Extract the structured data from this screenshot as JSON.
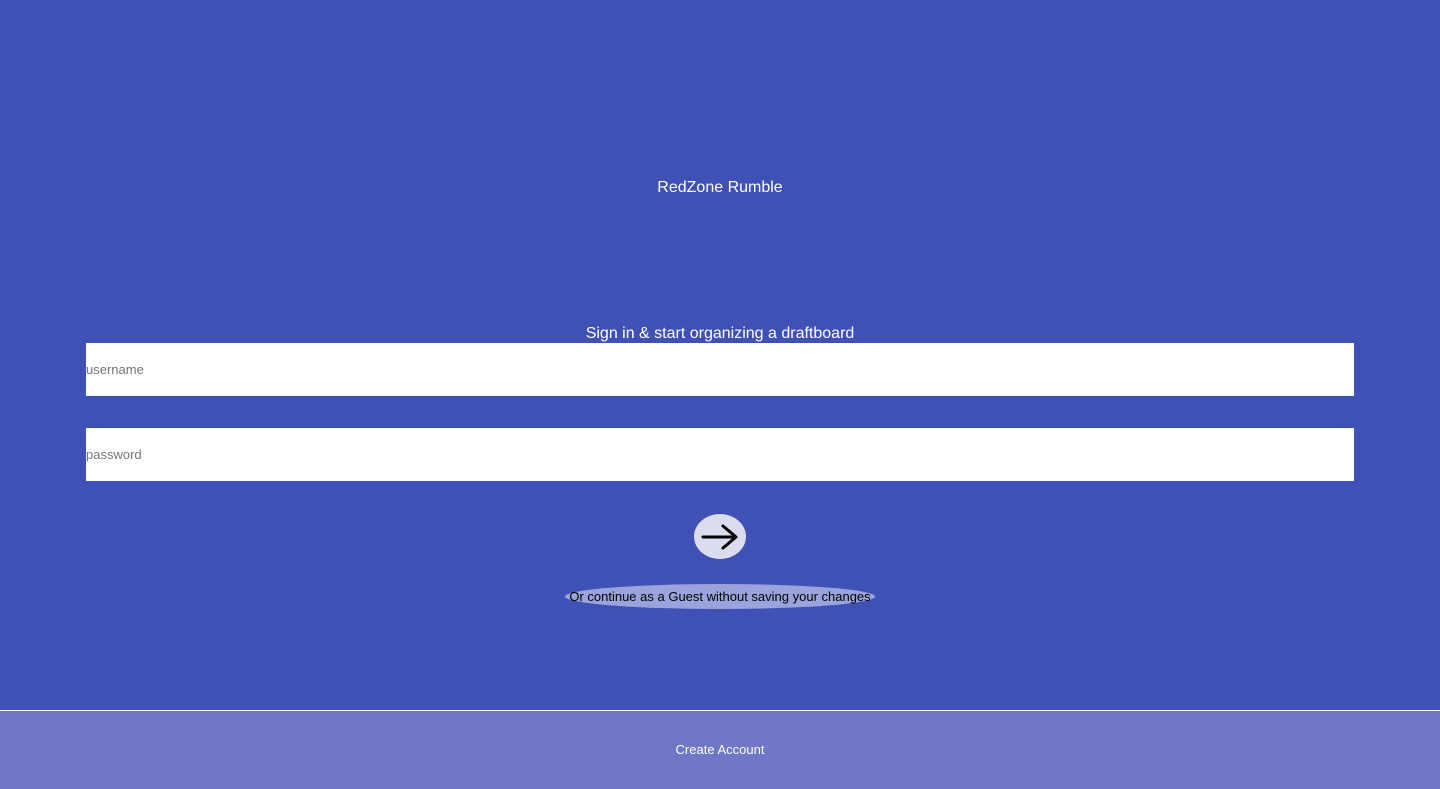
{
  "app": {
    "title": "RedZone Rumble",
    "subtitle": "Sign in & start organizing a draftboard"
  },
  "login_form": {
    "username": {
      "value": "",
      "placeholder": "username"
    },
    "password": {
      "value": "",
      "placeholder": "password"
    },
    "submit_icon": "arrow-right-icon"
  },
  "guest_link": {
    "label": "Or continue as a Guest without saving your changes"
  },
  "footer": {
    "create_account_label": "Create Account"
  },
  "colors": {
    "background": "#3f51b5",
    "footer": "#7077c5",
    "submit_button": "#dcdcf0",
    "guest_pill": "#9aa3dc"
  }
}
